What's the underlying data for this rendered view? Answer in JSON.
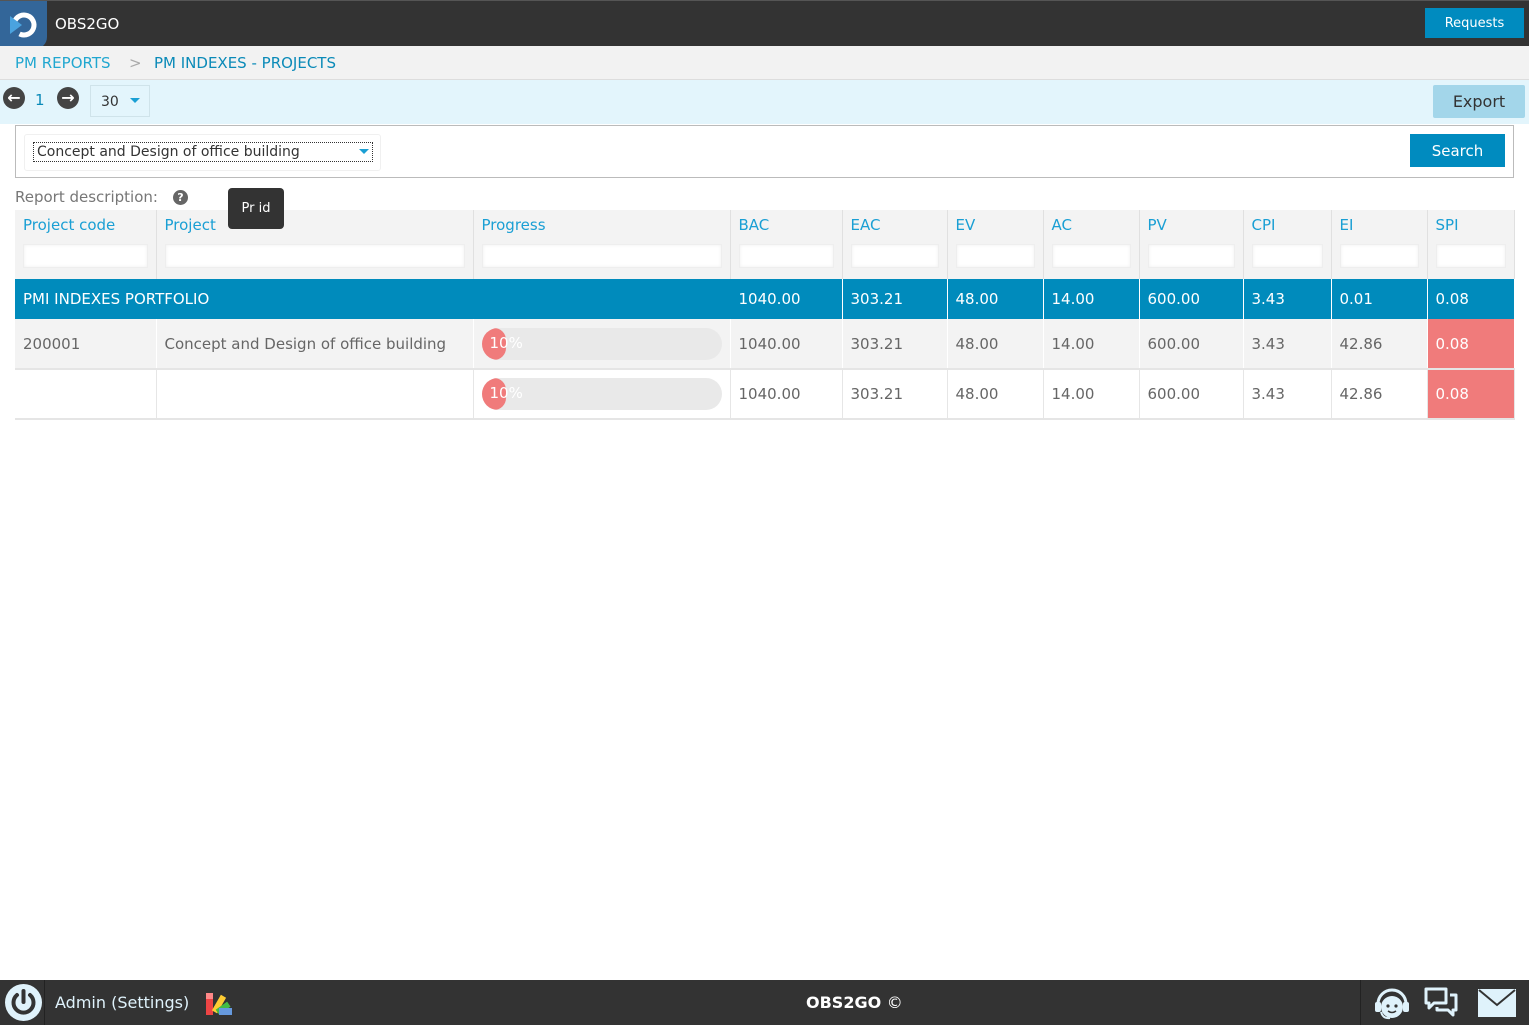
{
  "app": {
    "name": "OBS2GO",
    "requests_label": "Requests"
  },
  "breadcrumb": {
    "items": [
      "PM REPORTS",
      "PM INDEXES - PROJECTS"
    ],
    "separator": ">"
  },
  "pager": {
    "page": "1",
    "page_size": "30",
    "export_label": "Export"
  },
  "filter": {
    "selected_project": "Concept and Design of office building",
    "search_label": "Search"
  },
  "report": {
    "description_label": "Report description:",
    "tooltip": "Pr id"
  },
  "table": {
    "columns": [
      "Project code",
      "Project",
      "Progress",
      "BAC",
      "EAC",
      "EV",
      "AC",
      "PV",
      "CPI",
      "EI",
      "SPI"
    ],
    "portfolio_row": {
      "label": "PMI INDEXES PORTFOLIO",
      "bac": "1040.00",
      "eac": "303.21",
      "ev": "48.00",
      "ac": "14.00",
      "pv": "600.00",
      "cpi": "3.43",
      "ei": "0.01",
      "spi": "0.08"
    },
    "rows": [
      {
        "code": "200001",
        "project": "Concept and Design of office building",
        "progress": 10,
        "progress_label": "10%",
        "bac": "1040.00",
        "eac": "303.21",
        "ev": "48.00",
        "ac": "14.00",
        "pv": "600.00",
        "cpi": "3.43",
        "ei": "42.86",
        "spi": "0.08",
        "spi_status": "bad"
      },
      {
        "code": "",
        "project": "",
        "progress": 10,
        "progress_label": "10%",
        "bac": "1040.00",
        "eac": "303.21",
        "ev": "48.00",
        "ac": "14.00",
        "pv": "600.00",
        "cpi": "3.43",
        "ei": "42.86",
        "spi": "0.08",
        "spi_status": "bad"
      }
    ]
  },
  "footer": {
    "user_label": "Admin (Settings)",
    "copyright": "OBS2GO",
    "copyright_symbol": "©"
  },
  "colors": {
    "primary": "#008bbc",
    "danger": "#f07b7b",
    "topbar": "#333333",
    "link": "#1a9fd4"
  }
}
